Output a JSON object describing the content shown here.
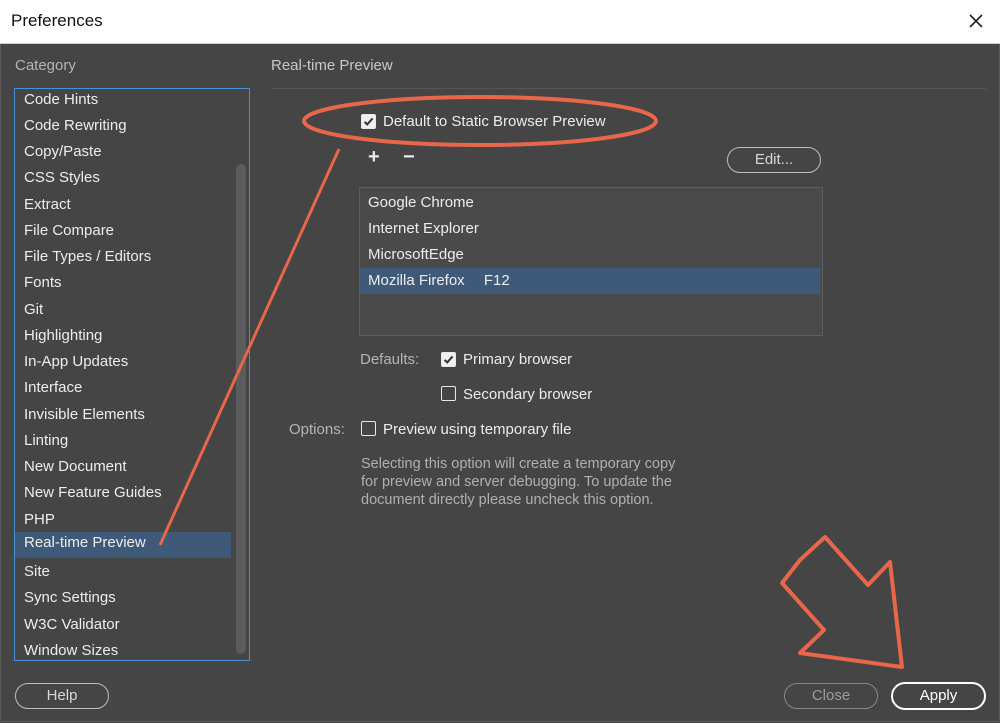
{
  "window": {
    "title": "Preferences"
  },
  "category": {
    "heading": "Category",
    "items": [
      "Code Hints",
      "Code Rewriting",
      "Copy/Paste",
      "CSS Styles",
      "Extract",
      "File Compare",
      "File Types / Editors",
      "Fonts",
      "Git",
      "Highlighting",
      "In-App Updates",
      "Interface",
      "Invisible Elements",
      "Linting",
      "New Document",
      "New Feature Guides",
      "PHP",
      "Real-time Preview",
      "Site",
      "Sync Settings",
      "W3C Validator",
      "Window Sizes"
    ],
    "selected": "Real-time Preview"
  },
  "panel": {
    "title": "Real-time Preview",
    "default_static": {
      "label": "Default to Static Browser Preview",
      "checked": true
    },
    "add_symbol": "+",
    "remove_symbol": "−",
    "edit_label": "Edit...",
    "browsers": [
      {
        "name": "Google Chrome",
        "key": ""
      },
      {
        "name": "Internet Explorer",
        "key": ""
      },
      {
        "name": "MicrosoftEdge",
        "key": ""
      },
      {
        "name": "Mozilla Firefox",
        "key": "F12"
      }
    ],
    "selected_browser": "Mozilla Firefox",
    "defaults_label": "Defaults:",
    "primary": {
      "label": "Primary browser",
      "checked": true
    },
    "secondary": {
      "label": "Secondary browser",
      "checked": false
    },
    "options_label": "Options:",
    "temp_file": {
      "label": "Preview using temporary file",
      "checked": false
    },
    "hint_lines": [
      "Selecting this option will create a temporary copy",
      "for preview and server debugging. To update the",
      "document directly please uncheck this option."
    ]
  },
  "footer": {
    "help": "Help",
    "close": "Close",
    "apply": "Apply"
  },
  "colors": {
    "accent": "#e8674a",
    "selection": "#3f5a78",
    "background": "#454545",
    "focus_border": "#4a90d9"
  },
  "icons": [
    "close-icon",
    "checkmark-icon",
    "plus-icon",
    "minus-icon",
    "arrow-annotation",
    "ellipse-annotation"
  ]
}
